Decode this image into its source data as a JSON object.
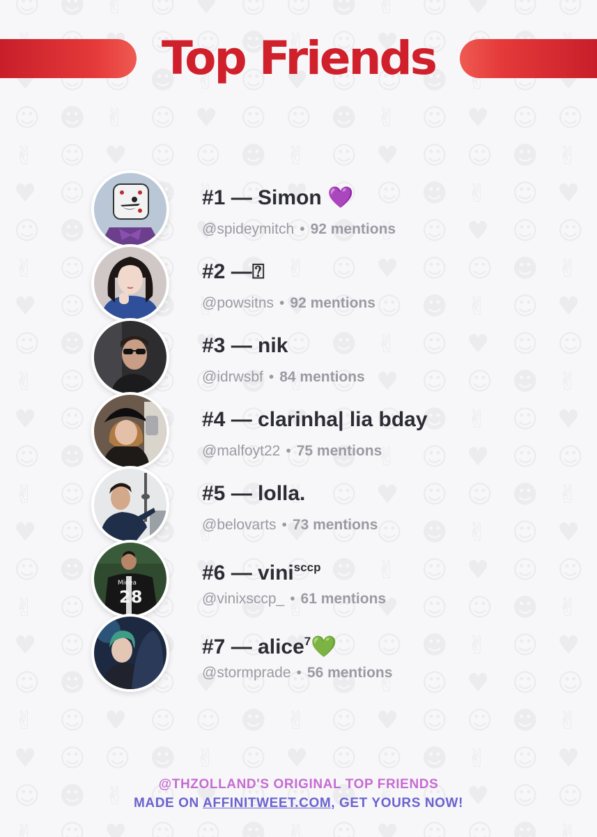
{
  "header": {
    "title": "Top Friends"
  },
  "colors": {
    "accent": "#d0202b",
    "footer_line1": "#c66bd2",
    "footer_line2": "#6a62cf"
  },
  "friends": [
    {
      "rank": "#1",
      "name": "Simon",
      "suffix": "💜",
      "sup": "",
      "handle": "@spideymitch",
      "mentions": "92 mentions",
      "avatar_icon": "cartoon-dice-avatar"
    },
    {
      "rank": "#2",
      "name": "",
      "suffix": "⍰",
      "sup": "",
      "handle": "@powsitns",
      "mentions": "92 mentions",
      "avatar_icon": "girl-photo-avatar"
    },
    {
      "rank": "#3",
      "name": "nik",
      "suffix": "",
      "sup": "",
      "handle": "@idrwsbf",
      "mentions": "84 mentions",
      "avatar_icon": "man-sunglasses-avatar"
    },
    {
      "rank": "#4",
      "name": "clarinha| lia bday",
      "suffix": "",
      "sup": "",
      "handle": "@malfoyt22",
      "mentions": "75 mentions",
      "avatar_icon": "girl-bucket-hat-avatar"
    },
    {
      "rank": "#5",
      "name": "lolla.",
      "suffix": "",
      "sup": "",
      "handle": "@belovarts",
      "mentions": "73 mentions",
      "avatar_icon": "man-city-tower-avatar"
    },
    {
      "rank": "#6",
      "name": "vini",
      "suffix": "",
      "sup": "sccp",
      "handle": "@vinixsccp_",
      "mentions": "61 mentions",
      "avatar_icon": "football-player-avatar"
    },
    {
      "rank": "#7",
      "name": "alice",
      "suffix": "💚",
      "sup": "7",
      "handle": "@stormprade",
      "mentions": "56 mentions",
      "avatar_icon": "performer-stage-avatar"
    }
  ],
  "footer": {
    "line1": "@THZOLLAND'S ORIGINAL TOP FRIENDS",
    "line2_prefix": "MADE ON ",
    "line2_link": "AFFINITWEET.COM",
    "line2_suffix": ", GET YOURS NOW!"
  }
}
